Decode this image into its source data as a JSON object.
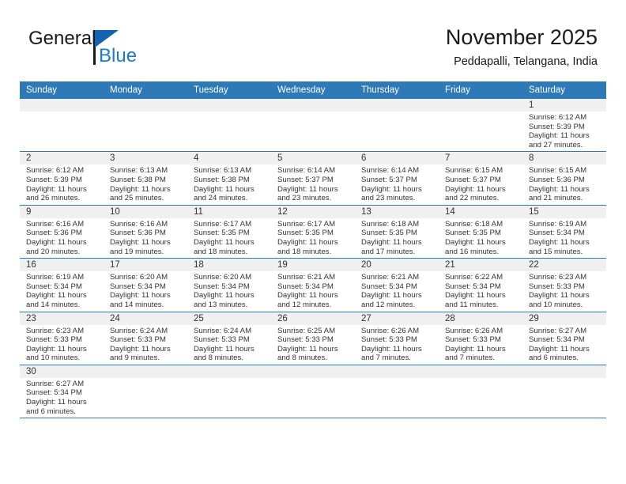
{
  "brand": {
    "name_top": "General",
    "name_bottom": "Blue",
    "triangle_icon": "brand-triangle-icon",
    "color_black": "#1a1a1a",
    "color_blue": "#1b7bc4"
  },
  "header": {
    "month_title": "November 2025",
    "location": "Peddapalli, Telangana, India"
  },
  "theme": {
    "header_blue": "#2e7ab8",
    "daynum_bg": "#f0f0f0",
    "text": "#333333"
  },
  "weekdays": [
    "Sunday",
    "Monday",
    "Tuesday",
    "Wednesday",
    "Thursday",
    "Friday",
    "Saturday"
  ],
  "labels": {
    "sunrise": "Sunrise:",
    "sunset": "Sunset:",
    "daylight": "Daylight:"
  },
  "weeks": [
    [
      {
        "empty": true
      },
      {
        "empty": true
      },
      {
        "empty": true
      },
      {
        "empty": true
      },
      {
        "empty": true
      },
      {
        "empty": true
      },
      {
        "day": "1",
        "sunrise": "Sunrise: 6:12 AM",
        "sunset": "Sunset: 5:39 PM",
        "daylight": "Daylight: 11 hours and 27 minutes."
      }
    ],
    [
      {
        "day": "2",
        "sunrise": "Sunrise: 6:12 AM",
        "sunset": "Sunset: 5:39 PM",
        "daylight": "Daylight: 11 hours and 26 minutes."
      },
      {
        "day": "3",
        "sunrise": "Sunrise: 6:13 AM",
        "sunset": "Sunset: 5:38 PM",
        "daylight": "Daylight: 11 hours and 25 minutes."
      },
      {
        "day": "4",
        "sunrise": "Sunrise: 6:13 AM",
        "sunset": "Sunset: 5:38 PM",
        "daylight": "Daylight: 11 hours and 24 minutes."
      },
      {
        "day": "5",
        "sunrise": "Sunrise: 6:14 AM",
        "sunset": "Sunset: 5:37 PM",
        "daylight": "Daylight: 11 hours and 23 minutes."
      },
      {
        "day": "6",
        "sunrise": "Sunrise: 6:14 AM",
        "sunset": "Sunset: 5:37 PM",
        "daylight": "Daylight: 11 hours and 23 minutes."
      },
      {
        "day": "7",
        "sunrise": "Sunrise: 6:15 AM",
        "sunset": "Sunset: 5:37 PM",
        "daylight": "Daylight: 11 hours and 22 minutes."
      },
      {
        "day": "8",
        "sunrise": "Sunrise: 6:15 AM",
        "sunset": "Sunset: 5:36 PM",
        "daylight": "Daylight: 11 hours and 21 minutes."
      }
    ],
    [
      {
        "day": "9",
        "sunrise": "Sunrise: 6:16 AM",
        "sunset": "Sunset: 5:36 PM",
        "daylight": "Daylight: 11 hours and 20 minutes."
      },
      {
        "day": "10",
        "sunrise": "Sunrise: 6:16 AM",
        "sunset": "Sunset: 5:36 PM",
        "daylight": "Daylight: 11 hours and 19 minutes."
      },
      {
        "day": "11",
        "sunrise": "Sunrise: 6:17 AM",
        "sunset": "Sunset: 5:35 PM",
        "daylight": "Daylight: 11 hours and 18 minutes."
      },
      {
        "day": "12",
        "sunrise": "Sunrise: 6:17 AM",
        "sunset": "Sunset: 5:35 PM",
        "daylight": "Daylight: 11 hours and 18 minutes."
      },
      {
        "day": "13",
        "sunrise": "Sunrise: 6:18 AM",
        "sunset": "Sunset: 5:35 PM",
        "daylight": "Daylight: 11 hours and 17 minutes."
      },
      {
        "day": "14",
        "sunrise": "Sunrise: 6:18 AM",
        "sunset": "Sunset: 5:35 PM",
        "daylight": "Daylight: 11 hours and 16 minutes."
      },
      {
        "day": "15",
        "sunrise": "Sunrise: 6:19 AM",
        "sunset": "Sunset: 5:34 PM",
        "daylight": "Daylight: 11 hours and 15 minutes."
      }
    ],
    [
      {
        "day": "16",
        "sunrise": "Sunrise: 6:19 AM",
        "sunset": "Sunset: 5:34 PM",
        "daylight": "Daylight: 11 hours and 14 minutes."
      },
      {
        "day": "17",
        "sunrise": "Sunrise: 6:20 AM",
        "sunset": "Sunset: 5:34 PM",
        "daylight": "Daylight: 11 hours and 14 minutes."
      },
      {
        "day": "18",
        "sunrise": "Sunrise: 6:20 AM",
        "sunset": "Sunset: 5:34 PM",
        "daylight": "Daylight: 11 hours and 13 minutes."
      },
      {
        "day": "19",
        "sunrise": "Sunrise: 6:21 AM",
        "sunset": "Sunset: 5:34 PM",
        "daylight": "Daylight: 11 hours and 12 minutes."
      },
      {
        "day": "20",
        "sunrise": "Sunrise: 6:21 AM",
        "sunset": "Sunset: 5:34 PM",
        "daylight": "Daylight: 11 hours and 12 minutes."
      },
      {
        "day": "21",
        "sunrise": "Sunrise: 6:22 AM",
        "sunset": "Sunset: 5:34 PM",
        "daylight": "Daylight: 11 hours and 11 minutes."
      },
      {
        "day": "22",
        "sunrise": "Sunrise: 6:23 AM",
        "sunset": "Sunset: 5:33 PM",
        "daylight": "Daylight: 11 hours and 10 minutes."
      }
    ],
    [
      {
        "day": "23",
        "sunrise": "Sunrise: 6:23 AM",
        "sunset": "Sunset: 5:33 PM",
        "daylight": "Daylight: 11 hours and 10 minutes."
      },
      {
        "day": "24",
        "sunrise": "Sunrise: 6:24 AM",
        "sunset": "Sunset: 5:33 PM",
        "daylight": "Daylight: 11 hours and 9 minutes."
      },
      {
        "day": "25",
        "sunrise": "Sunrise: 6:24 AM",
        "sunset": "Sunset: 5:33 PM",
        "daylight": "Daylight: 11 hours and 8 minutes."
      },
      {
        "day": "26",
        "sunrise": "Sunrise: 6:25 AM",
        "sunset": "Sunset: 5:33 PM",
        "daylight": "Daylight: 11 hours and 8 minutes."
      },
      {
        "day": "27",
        "sunrise": "Sunrise: 6:26 AM",
        "sunset": "Sunset: 5:33 PM",
        "daylight": "Daylight: 11 hours and 7 minutes."
      },
      {
        "day": "28",
        "sunrise": "Sunrise: 6:26 AM",
        "sunset": "Sunset: 5:33 PM",
        "daylight": "Daylight: 11 hours and 7 minutes."
      },
      {
        "day": "29",
        "sunrise": "Sunrise: 6:27 AM",
        "sunset": "Sunset: 5:34 PM",
        "daylight": "Daylight: 11 hours and 6 minutes."
      }
    ],
    [
      {
        "day": "30",
        "sunrise": "Sunrise: 6:27 AM",
        "sunset": "Sunset: 5:34 PM",
        "daylight": "Daylight: 11 hours and 6 minutes."
      },
      {
        "empty": true
      },
      {
        "empty": true
      },
      {
        "empty": true
      },
      {
        "empty": true
      },
      {
        "empty": true
      },
      {
        "empty": true
      }
    ]
  ]
}
